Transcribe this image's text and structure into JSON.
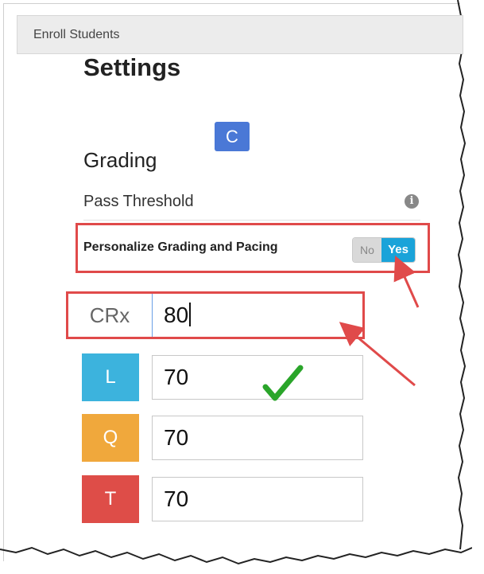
{
  "header": {
    "title": "Enroll Students"
  },
  "settings": {
    "title": "Settings",
    "badge": "C",
    "grading_title": "Grading",
    "pass_threshold_label": "Pass Threshold",
    "personalize_label": "Personalize Grading and Pacing",
    "toggle": {
      "no_label": "No",
      "yes_label": "Yes",
      "selected": "Yes"
    }
  },
  "thresholds": [
    {
      "label": "CRx",
      "value": "80",
      "color": "#ffffff"
    },
    {
      "label": "L",
      "value": "70",
      "color": "#3cb3dd"
    },
    {
      "label": "Q",
      "value": "70",
      "color": "#f0a83c"
    },
    {
      "label": "T",
      "value": "70",
      "color": "#de4d48"
    }
  ],
  "annotation_colors": {
    "box": "#e04a4a",
    "check": "#2aa52a"
  }
}
